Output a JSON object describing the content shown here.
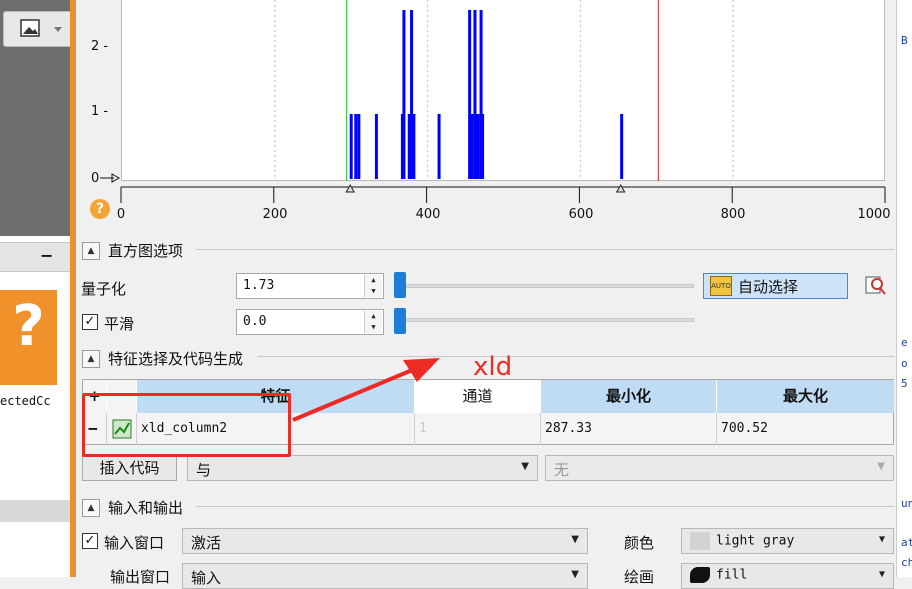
{
  "chart": {
    "y_ticks": [
      "2 -",
      "1 -",
      "0"
    ],
    "x_ticks": [
      "0",
      "200",
      "400",
      "600",
      "800",
      "1000"
    ],
    "help_icon": "?"
  },
  "chart_data": {
    "type": "bar",
    "xlim": [
      0,
      1000
    ],
    "ylim": [
      0,
      2.6
    ],
    "bars": [
      {
        "x": 300,
        "h": 1
      },
      {
        "x": 306,
        "h": 1
      },
      {
        "x": 310,
        "h": 1
      },
      {
        "x": 333,
        "h": 1
      },
      {
        "x": 367,
        "h": 1
      },
      {
        "x": 369,
        "h": 2.6
      },
      {
        "x": 376,
        "h": 1
      },
      {
        "x": 379,
        "h": 2.6
      },
      {
        "x": 382,
        "h": 1
      },
      {
        "x": 415,
        "h": 1
      },
      {
        "x": 455,
        "h": 2.6
      },
      {
        "x": 458,
        "h": 1
      },
      {
        "x": 462,
        "h": 2.6
      },
      {
        "x": 464,
        "h": 1
      },
      {
        "x": 466,
        "h": 1
      },
      {
        "x": 470,
        "h": 2.6
      },
      {
        "x": 472,
        "h": 1
      },
      {
        "x": 654,
        "h": 1
      }
    ],
    "green_line_x": 294,
    "red_line_x": 702,
    "markers_x": [
      300,
      654
    ],
    "bar_color": "#0000ff",
    "green_color": "#22cc22",
    "red_color": "#dd2222"
  },
  "hist_options": {
    "title": "直方图选项",
    "quantize_label": "量子化",
    "quantize_value": "1.73",
    "smooth_label": "平滑",
    "smooth_value": "0.0",
    "auto_select_label": "自动选择"
  },
  "feature_section": {
    "title": "特征选择及代码生成",
    "columns": [
      "+",
      "特征",
      "通道",
      "最小化",
      "最大化"
    ],
    "row": {
      "minus": "−",
      "feature": "xld_column2",
      "channel": "1",
      "min": "287.33",
      "max": "700.52"
    },
    "insert_code_label": "插入代码",
    "combine_value": "与",
    "disabled_value": "无"
  },
  "io_section": {
    "title": "输入和输出",
    "input_window_label": "输入窗口",
    "input_window_value": "激活",
    "color_label": "颜色",
    "color_value": "light gray",
    "output_window_label": "输出窗口",
    "output_window_value": "输入",
    "draw_label": "绘画",
    "draw_value": "fill"
  },
  "annotation": {
    "text": "xld",
    "color": "#ee2a25"
  },
  "left_panel": {
    "minus": "−",
    "label": "ectedCc",
    "q": "?"
  },
  "right_panel": {
    "texts": [
      "B",
      "e",
      "o",
      "5",
      "un",
      "at",
      "ch"
    ]
  }
}
